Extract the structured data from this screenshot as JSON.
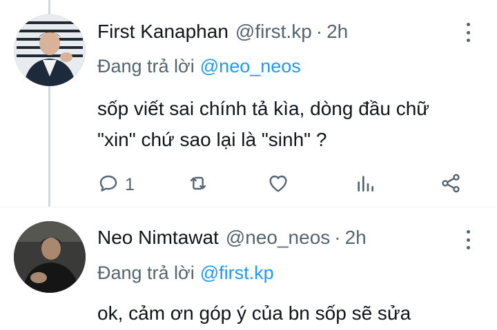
{
  "tweets": [
    {
      "name": "First Kanaphan",
      "handle": "@first.kp",
      "separator": "·",
      "time": "2h",
      "reply_prefix": "Đang trả lời",
      "reply_to": "@neo_neos",
      "text_line1": "sốp viết sai chính tả kìa, dòng đầu chữ",
      "text_line2": "\"xin\" chứ sao lại là \"sinh\" ?",
      "reply_count": "1",
      "icons": [
        "reply-icon",
        "retweet-icon",
        "like-icon",
        "views-icon",
        "share-icon",
        "more-icon"
      ]
    },
    {
      "name": "Neo Nimtawat",
      "handle": "@neo_neos",
      "separator": "·",
      "time": "2h",
      "reply_prefix": "Đang trả lời",
      "reply_to": "@first.kp",
      "text_line1": "ok, cảm ơn góp ý của bn sốp sẽ sửa"
    }
  ],
  "colors": {
    "text": "#0f1419",
    "secondary": "#536471",
    "accent": "#1d9bf0",
    "thread_line": "#cfd9de"
  }
}
